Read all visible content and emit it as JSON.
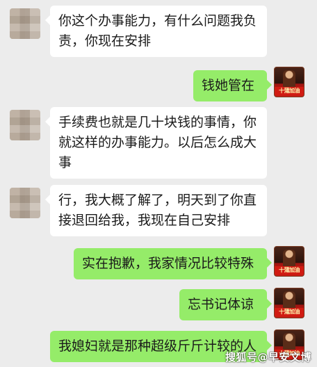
{
  "conversation": {
    "messages": [
      {
        "side": "left",
        "avatar": "blurred-avatar",
        "text": "你这个办事能力，有什么问题我负责，你现在安排"
      },
      {
        "side": "right",
        "avatar": "self-avatar",
        "text": "钱她管在"
      },
      {
        "side": "left",
        "avatar": "blurred-avatar",
        "text": "手续费也就是几十块钱的事情，你就这样的办事能力。以后怎么成大事"
      },
      {
        "side": "left",
        "avatar": "blurred-avatar",
        "text": "行，我大概了解了，明天到了你直接退回给我，我现在自己安排"
      },
      {
        "side": "right",
        "avatar": "self-avatar",
        "text": "实在抱歉，我家情况比较特殊"
      },
      {
        "side": "right",
        "avatar": "self-avatar",
        "text": "忘书记体谅"
      },
      {
        "side": "right",
        "avatar": "self-avatar",
        "text": "我媳妇就是那种超级斤斤计较的人"
      }
    ]
  },
  "self_avatar_tag": "十蒲加油",
  "watermark": "搜狐号@早安文博",
  "colors": {
    "background": "#ececec",
    "left_bubble": "#ffffff",
    "right_bubble": "#95ec69"
  }
}
